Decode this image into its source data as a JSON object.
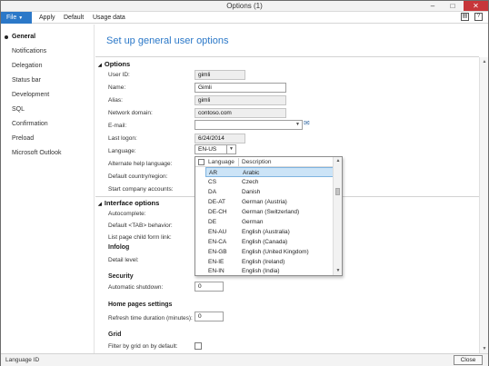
{
  "window": {
    "title": "Options (1)",
    "min": "–",
    "max": "□",
    "close": "✕"
  },
  "ribbon": {
    "file": "File",
    "items": [
      "Apply",
      "Default",
      "Usage data"
    ],
    "icons": [
      "▤",
      "?"
    ]
  },
  "sidebar": {
    "items": [
      "General",
      "Notifications",
      "Delegation",
      "Status bar",
      "Development",
      "SQL",
      "Confirmation",
      "Preload",
      "Microsoft Outlook"
    ],
    "active_index": 0
  },
  "main": {
    "title": "Set up general user options",
    "sections": {
      "options": "Options",
      "interface": "Interface options"
    },
    "fields": {
      "user_id": {
        "label": "User ID:",
        "value": "gimli"
      },
      "name": {
        "label": "Name:",
        "value": "Gimli"
      },
      "alias": {
        "label": "Alias:",
        "value": "gimli"
      },
      "network_domain": {
        "label": "Network domain:",
        "value": "contoso.com"
      },
      "email": {
        "label": "E-mail:",
        "value": ""
      },
      "last_logon": {
        "label": "Last logon:",
        "value": "6/24/2014"
      },
      "language": {
        "label": "Language:",
        "value": "EN-US"
      },
      "alt_help_language": {
        "label": "Alternate help language:"
      },
      "default_country": {
        "label": "Default country/region:"
      },
      "start_company": {
        "label": "Start company accounts:"
      },
      "autocomplete": {
        "label": "Autocomplete:"
      },
      "tab_behavior": {
        "label": "Default <TAB> behavior:"
      },
      "list_page_link": {
        "label": "List page child form link:"
      },
      "infolog_hdr": "Infolog",
      "detail_level": {
        "label": "Detail level:"
      },
      "security_hdr": "Security",
      "auto_shutdown": {
        "label": "Automatic shutdown:",
        "value": "0"
      },
      "home_pages_hdr": "Home pages settings",
      "refresh_duration": {
        "label": "Refresh time duration (minutes):",
        "value": "0"
      },
      "grid_hdr": "Grid",
      "filter_by_grid": {
        "label": "Filter by grid on by default:"
      }
    }
  },
  "language_dropdown": {
    "col_language": "Language",
    "col_description": "Description",
    "rows": [
      {
        "code": "AR",
        "desc": "Arabic"
      },
      {
        "code": "CS",
        "desc": "Czech"
      },
      {
        "code": "DA",
        "desc": "Danish"
      },
      {
        "code": "DE-AT",
        "desc": "German (Austria)"
      },
      {
        "code": "DE-CH",
        "desc": "German (Switzerland)"
      },
      {
        "code": "DE",
        "desc": "German"
      },
      {
        "code": "EN-AU",
        "desc": "English (Australia)"
      },
      {
        "code": "EN-CA",
        "desc": "English (Canada)"
      },
      {
        "code": "EN-GB",
        "desc": "English (United Kingdom)"
      },
      {
        "code": "EN-IE",
        "desc": "English (Ireland)"
      },
      {
        "code": "EN-IN",
        "desc": "English (India)"
      }
    ],
    "selected_index": 0
  },
  "status": {
    "text": "Language ID",
    "close_button": "Close"
  }
}
